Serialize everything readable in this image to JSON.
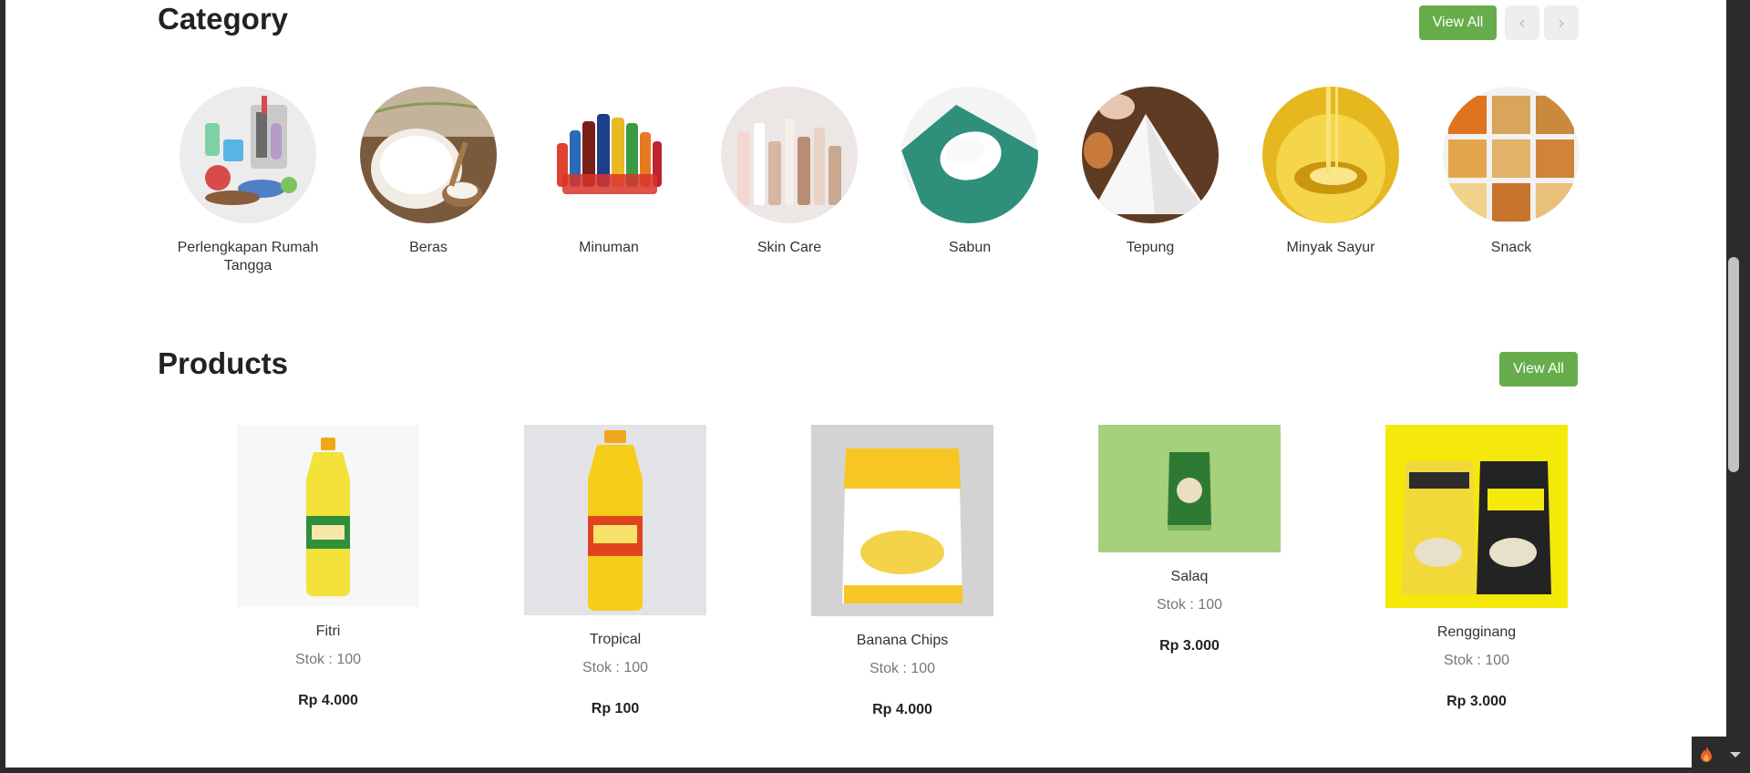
{
  "category": {
    "title": "Category",
    "view_all_label": "View All",
    "prev_label": "‹",
    "next_label": "›",
    "items": [
      {
        "label": "Perlengkapan Rumah Tangga",
        "icon": "household-image"
      },
      {
        "label": "Beras",
        "icon": "rice-image"
      },
      {
        "label": "Minuman",
        "icon": "drinks-image"
      },
      {
        "label": "Skin Care",
        "icon": "skincare-image"
      },
      {
        "label": "Sabun",
        "icon": "soap-image"
      },
      {
        "label": "Tepung",
        "icon": "flour-image"
      },
      {
        "label": "Minyak Sayur",
        "icon": "oil-image"
      },
      {
        "label": "Snack",
        "icon": "snack-image"
      }
    ]
  },
  "products": {
    "title": "Products",
    "view_all_label": "View All",
    "items": [
      {
        "name": "Fitri",
        "stock": "Stok : 100",
        "price": "Rp 4.000"
      },
      {
        "name": "Tropical",
        "stock": "Stok : 100",
        "price": "Rp 100"
      },
      {
        "name": "Banana Chips",
        "stock": "Stok : 100",
        "price": "Rp 4.000"
      },
      {
        "name": "Salaq",
        "stock": "Stok : 100",
        "price": "Rp 3.000"
      },
      {
        "name": "Rengginang",
        "stock": "Stok : 100",
        "price": "Rp 3.000"
      }
    ]
  },
  "colors": {
    "accent_green": "#67ad4b",
    "nav_button_bg": "#eeeeee",
    "page_bg": "#ffffff",
    "chrome_bg": "#2b2b2b"
  }
}
